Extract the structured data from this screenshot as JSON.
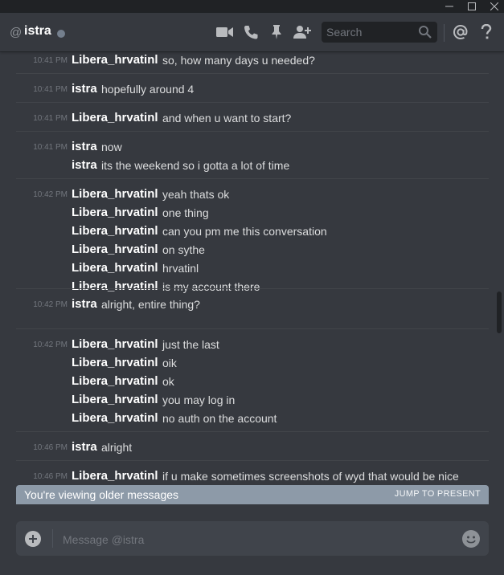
{
  "window": {
    "minimize_icon": "minimize-icon",
    "maximize_icon": "maximize-icon",
    "close_icon": "close-icon"
  },
  "header": {
    "at_symbol": "@",
    "channel_name": "istra",
    "status": "offline",
    "status_color": "#747f8d",
    "icons": [
      "video-call-icon",
      "voice-call-icon",
      "pin-icon",
      "add-friend-icon",
      "mention-icon",
      "help-icon"
    ],
    "search_placeholder": "Search"
  },
  "messages": [
    {
      "time": "10:41 PM",
      "lines": [
        {
          "author": "Libera_hrvatinl",
          "text": "so, how many days u needed?"
        }
      ]
    },
    {
      "time": "10:41 PM",
      "lines": [
        {
          "author": "istra",
          "text": "hopefully around 4"
        }
      ]
    },
    {
      "time": "10:41 PM",
      "lines": [
        {
          "author": "Libera_hrvatinl",
          "text": "and when u want to start?"
        }
      ]
    },
    {
      "time": "10:41 PM",
      "lines": [
        {
          "author": "istra",
          "text": "now"
        },
        {
          "author": "istra",
          "text": "its the weekend so i gotta a lot of time"
        }
      ]
    },
    {
      "time": "10:42 PM",
      "lines": [
        {
          "author": "Libera_hrvatinl",
          "text": "yeah thats ok"
        },
        {
          "author": "Libera_hrvatinl",
          "text": "one thing"
        },
        {
          "author": "Libera_hrvatinl",
          "text": "can you pm me this conversation"
        },
        {
          "author": "Libera_hrvatinl",
          "text": "on sythe"
        },
        {
          "author": "Libera_hrvatinl",
          "text": "hrvatinl"
        },
        {
          "author": "Libera_hrvatinl",
          "text": "is my account there"
        }
      ]
    },
    {
      "time": "10:42 PM",
      "lines": [
        {
          "author": "istra",
          "text": "alright, entire thing?"
        }
      ]
    },
    {
      "time": "10:42 PM",
      "lines": [
        {
          "author": "Libera_hrvatinl",
          "text": "just the last"
        },
        {
          "author": "Libera_hrvatinl",
          "text": "oik"
        },
        {
          "author": "Libera_hrvatinl",
          "text": "ok"
        },
        {
          "author": "Libera_hrvatinl",
          "text": "you may log in"
        },
        {
          "author": "Libera_hrvatinl",
          "text": "no auth on the account"
        }
      ]
    },
    {
      "time": "10:46 PM",
      "lines": [
        {
          "author": "istra",
          "text": "alright"
        }
      ]
    },
    {
      "time": "10:46 PM",
      "lines": [
        {
          "author": "Libera_hrvatinl",
          "text": "if u make sometimes screenshots of wyd that would be nice"
        }
      ]
    }
  ],
  "older_bar": {
    "label": "You're viewing older messages",
    "jump_label": "JUMP TO PRESENT",
    "color": "#8d9aa8"
  },
  "composer": {
    "placeholder": "Message @istra",
    "add_icon": "add-attachment-icon",
    "emoji_icon": "emoji-icon"
  },
  "theme": {
    "background": "#36393f",
    "author_color": "#ffffff",
    "text_color": "#dcddde",
    "timestamp_color": "#72767d"
  }
}
